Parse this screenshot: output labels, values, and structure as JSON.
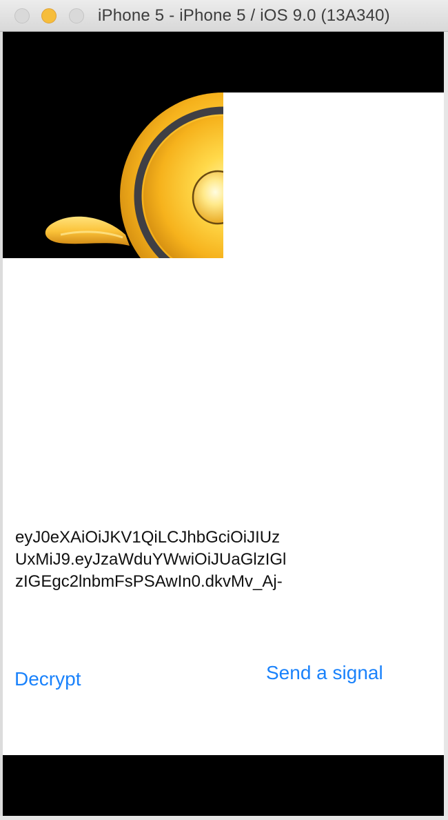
{
  "window": {
    "title": "iPhone 5 - iPhone 5 / iOS 9.0 (13A340)"
  },
  "colors": {
    "accent": "#1a82fb",
    "screen_background": "#ffffff",
    "letterbox": "#000000"
  },
  "screen": {
    "token_text": "eyJ0eXAiOiJKV1QiLCJhbGciOiJIUz\nUxMiJ9.eyJzaWduYWwiOiJUaGlzIGl\nzIGEgc2lnbmFsPSAwIn0.dkvMv_Aj-",
    "decrypt_label": "Decrypt",
    "send_signal_label": "Send a signal"
  },
  "icons": {
    "close": "close-traffic-light",
    "minimize": "minimize-traffic-light",
    "zoom": "zoom-traffic-light"
  }
}
